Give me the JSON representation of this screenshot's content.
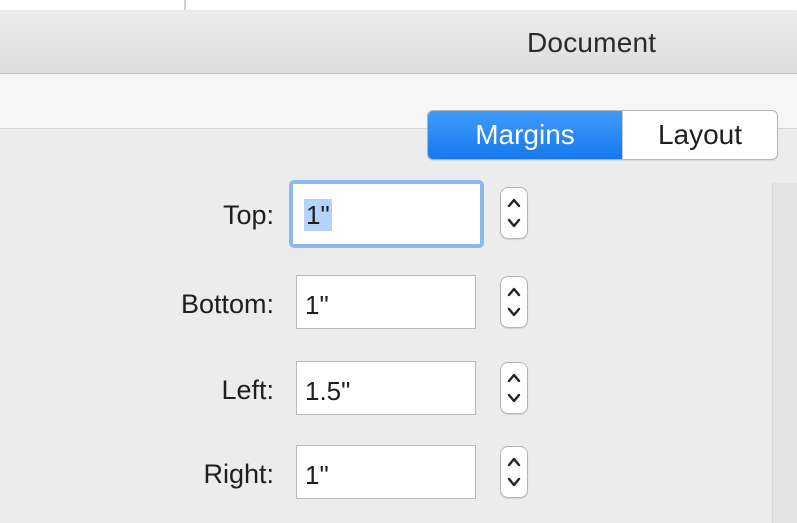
{
  "window": {
    "title": "Document"
  },
  "tabs": [
    {
      "label": "Margins",
      "selected": true
    },
    {
      "label": "Layout",
      "selected": false
    }
  ],
  "margins": {
    "fields": [
      {
        "label": "Top:",
        "value": "1\"",
        "focused": true
      },
      {
        "label": "Bottom:",
        "value": "1\"",
        "focused": false
      },
      {
        "label": "Left:",
        "value": "1.5\"",
        "focused": false
      },
      {
        "label": "Right:",
        "value": "1\"",
        "focused": false
      }
    ]
  },
  "icons": {
    "stepper_up": "chevron-up-icon",
    "stepper_down": "chevron-down-icon"
  },
  "colors": {
    "accent": "#1f7cf0",
    "focus_ring": "#8fb7ef",
    "selection": "#b3d3fb"
  }
}
